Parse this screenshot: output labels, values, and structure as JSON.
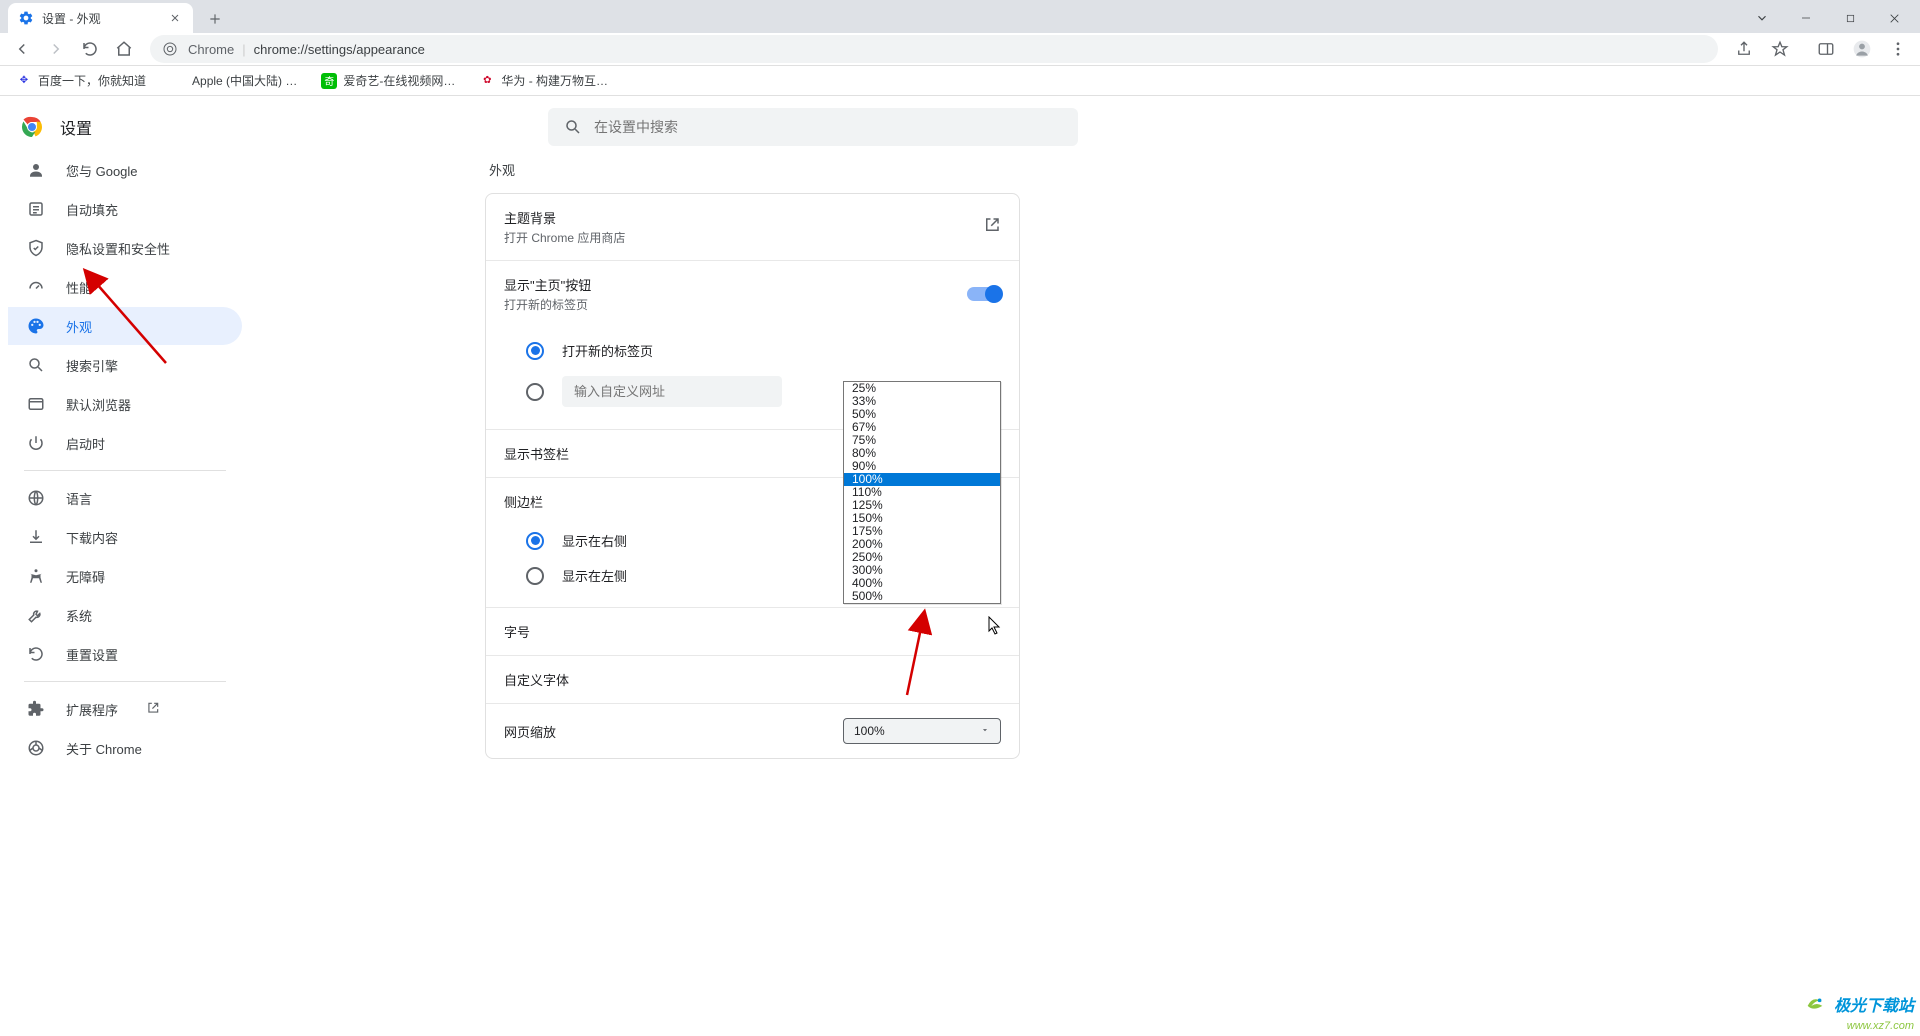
{
  "window": {
    "tab_title": "设置 - 外观"
  },
  "address": {
    "chrome_label": "Chrome",
    "url": "chrome://settings/appearance"
  },
  "bookmarks": [
    {
      "label": "百度一下，你就知道",
      "color": "#2932e1"
    },
    {
      "label": "Apple (中国大陆) …",
      "color": "#888"
    },
    {
      "label": "爱奇艺-在线视频网…",
      "color": "#00be06"
    },
    {
      "label": "华为 - 构建万物互…",
      "color": "#cf0a2c"
    }
  ],
  "settings": {
    "title": "设置",
    "search_placeholder": "在设置中搜索"
  },
  "sidebar": {
    "items": [
      {
        "label": "您与 Google",
        "icon": "person"
      },
      {
        "label": "自动填充",
        "icon": "autofill"
      },
      {
        "label": "隐私设置和安全性",
        "icon": "shield"
      },
      {
        "label": "性能",
        "icon": "speed"
      },
      {
        "label": "外观",
        "icon": "palette",
        "active": true
      },
      {
        "label": "搜索引擎",
        "icon": "search"
      },
      {
        "label": "默认浏览器",
        "icon": "browser"
      },
      {
        "label": "启动时",
        "icon": "power"
      }
    ],
    "items2": [
      {
        "label": "语言",
        "icon": "globe"
      },
      {
        "label": "下载内容",
        "icon": "download"
      },
      {
        "label": "无障碍",
        "icon": "accessibility"
      },
      {
        "label": "系统",
        "icon": "wrench"
      },
      {
        "label": "重置设置",
        "icon": "reset"
      }
    ],
    "items3": [
      {
        "label": "扩展程序",
        "icon": "extension",
        "external": true
      },
      {
        "label": "关于 Chrome",
        "icon": "chrome"
      }
    ]
  },
  "main": {
    "section_title": "外观",
    "theme": {
      "title": "主题背景",
      "sub": "打开 Chrome 应用商店"
    },
    "home_button": {
      "title": "显示\"主页\"按钮",
      "sub": "打开新的标签页"
    },
    "home_radio": {
      "option1": "打开新的标签页",
      "option2_placeholder": "输入自定义网址"
    },
    "bookmarks_bar": {
      "title": "显示书签栏"
    },
    "sidebar_pos": {
      "title": "侧边栏",
      "option1": "显示在右侧",
      "option2": "显示在左侧"
    },
    "font_size": {
      "title": "字号"
    },
    "custom_font": {
      "title": "自定义字体"
    },
    "zoom": {
      "title": "网页缩放",
      "value": "100%",
      "options": [
        "25%",
        "33%",
        "50%",
        "67%",
        "75%",
        "80%",
        "90%",
        "100%",
        "110%",
        "125%",
        "150%",
        "175%",
        "200%",
        "250%",
        "300%",
        "400%",
        "500%"
      ],
      "selected": "100%"
    }
  },
  "watermark": {
    "title": "极光下载站",
    "url": "www.xz7.com"
  }
}
